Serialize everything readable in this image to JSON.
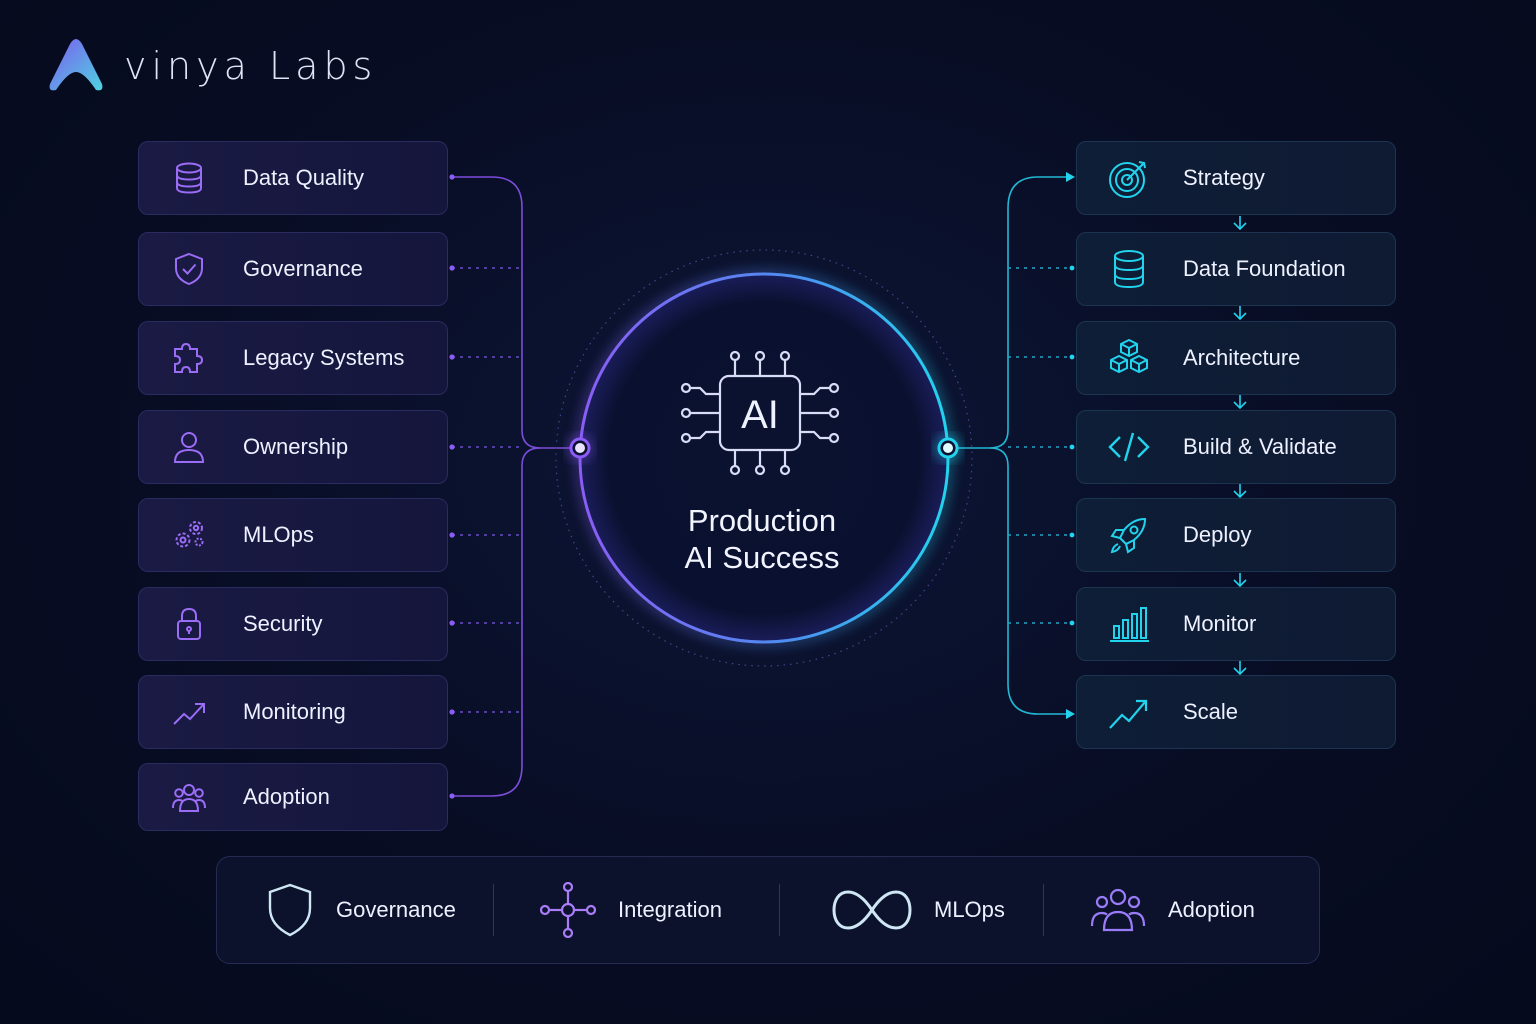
{
  "brand": {
    "name": "vinya Labs"
  },
  "center": {
    "chip_label": "AI",
    "title_line1": "Production",
    "title_line2": "AI Success"
  },
  "challenges": [
    {
      "label": "Data Quality",
      "icon": "database-icon"
    },
    {
      "label": "Governance",
      "icon": "shield-check-icon"
    },
    {
      "label": "Legacy Systems",
      "icon": "puzzle-icon"
    },
    {
      "label": "Ownership",
      "icon": "user-icon"
    },
    {
      "label": "MLOps",
      "icon": "gears-icon"
    },
    {
      "label": "Security",
      "icon": "lock-icon"
    },
    {
      "label": "Monitoring",
      "icon": "trend-up-icon"
    },
    {
      "label": "Adoption",
      "icon": "users-icon"
    }
  ],
  "steps": [
    {
      "label": "Strategy",
      "icon": "target-icon"
    },
    {
      "label": "Data Foundation",
      "icon": "database-icon"
    },
    {
      "label": "Architecture",
      "icon": "cubes-icon"
    },
    {
      "label": "Build & Validate",
      "icon": "code-icon"
    },
    {
      "label": "Deploy",
      "icon": "rocket-icon"
    },
    {
      "label": "Monitor",
      "icon": "bar-chart-icon"
    },
    {
      "label": "Scale",
      "icon": "trend-up-icon"
    }
  ],
  "pillars": [
    {
      "label": "Governance",
      "icon": "shield-icon"
    },
    {
      "label": "Integration",
      "icon": "hub-icon"
    },
    {
      "label": "MLOps",
      "icon": "infinity-icon"
    },
    {
      "label": "Adoption",
      "icon": "users-icon"
    }
  ],
  "colors": {
    "purple": "#8b5cf6",
    "cyan": "#22d3ee",
    "background": "#070c22"
  }
}
